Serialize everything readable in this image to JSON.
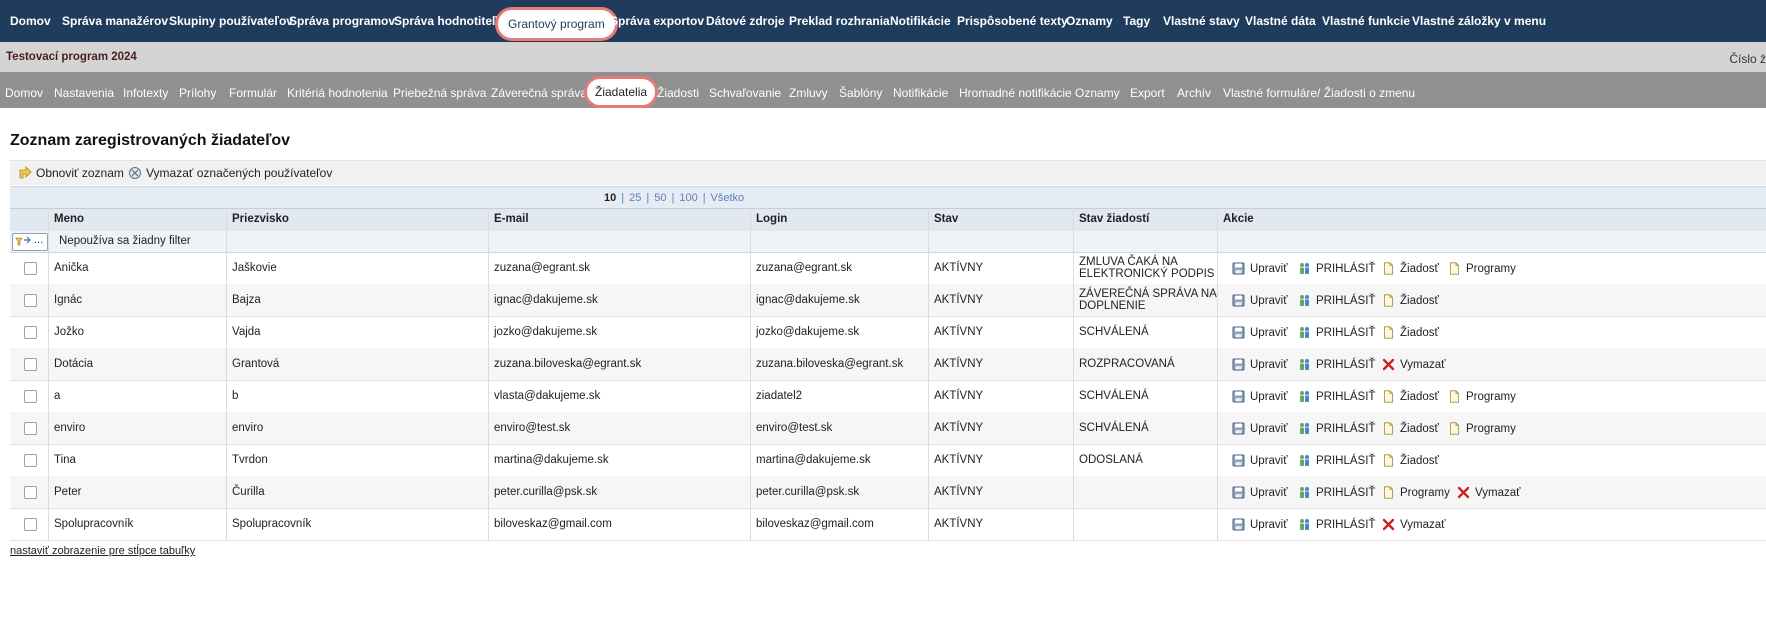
{
  "top_nav": [
    "Domov",
    "Správa manažérov",
    "Skupiny používateľov",
    "Správa programov",
    "Správa hodnotiteľov",
    "Grantový program",
    "Správa exportov",
    "Dátové zdroje",
    "Preklad rozhrania",
    "Notifikácie",
    "Prispôsobené texty",
    "Oznamy",
    "Tagy",
    "Vlastné stavy",
    "Vlastné dáta",
    "Vlastné funkcie",
    "Vlastné záložky v menu"
  ],
  "top_nav_active": "Grantový program",
  "program_title": "Testovací program 2024",
  "cislo_label": "Číslo ž",
  "sub_nav": [
    "Domov",
    "Nastavenia",
    "Infotexty",
    "Prílohy",
    "Formulár",
    "Kritériá hodnotenia",
    "Priebežná správa",
    "Záverečná správa",
    "Žiadatelia",
    "Žiadosti",
    "Schvaľovanie",
    "Zmluvy",
    "Šablóny",
    "Notifikácie",
    "Hromadné notifikácie",
    "Oznamy",
    "Export",
    "Archív",
    "Vlastné formuláre/ Žiadosti o zmenu"
  ],
  "sub_nav_active": "Žiadatelia",
  "page_title": "Zoznam zaregistrovaných žiadateľov",
  "toolbar": {
    "refresh": "Obnoviť zoznam",
    "delete_selected": "Vymazať označených používateľov"
  },
  "pager": {
    "current": "10",
    "options": [
      "25",
      "50",
      "100",
      "Všetko"
    ]
  },
  "columns": [
    "Meno",
    "Priezvisko",
    "E-mail",
    "Login",
    "Stav",
    "Stav žiadostí",
    "Akcie"
  ],
  "filter": {
    "button": "...",
    "text": "Nepoužíva sa žiadny filter"
  },
  "rows": [
    {
      "meno": "Anička",
      "priezvisko": "Jaškovie",
      "email": "zuzana@egrant.sk",
      "login": "zuzana@egrant.sk",
      "stav": "AKTÍVNY",
      "stav_ziadosti": [
        "ZMLUVA ČAKÁ NA",
        "ELEKTRONICKÝ PODPIS"
      ],
      "actions": [
        "Upraviť",
        "PRIHLÁSIŤ",
        "Žiadosť",
        "Programy"
      ]
    },
    {
      "meno": "Ignác",
      "priezvisko": "Bajza",
      "email": "ignac@dakujeme.sk",
      "login": "ignac@dakujeme.sk",
      "stav": "AKTÍVNY",
      "stav_ziadosti": [
        "ZÁVEREČNÁ SPRÁVA NA",
        "DOPLNENIE"
      ],
      "actions": [
        "Upraviť",
        "PRIHLÁSIŤ",
        "Žiadosť"
      ]
    },
    {
      "meno": "Jožko",
      "priezvisko": "Vajda",
      "email": "jozko@dakujeme.sk",
      "login": "jozko@dakujeme.sk",
      "stav": "AKTÍVNY",
      "stav_ziadosti": [
        "SCHVÁLENÁ"
      ],
      "actions": [
        "Upraviť",
        "PRIHLÁSIŤ",
        "Žiadosť"
      ]
    },
    {
      "meno": "Dotácia",
      "priezvisko": "Grantová",
      "email": "zuzana.biloveska@egrant.sk",
      "login": "zuzana.biloveska@egrant.sk",
      "stav": "AKTÍVNY",
      "stav_ziadosti": [
        "ROZPRACOVANÁ"
      ],
      "actions": [
        "Upraviť",
        "PRIHLÁSIŤ",
        "Vymazať"
      ]
    },
    {
      "meno": "a",
      "priezvisko": "b",
      "email": "vlasta@dakujeme.sk",
      "login": "ziadatel2",
      "stav": "AKTÍVNY",
      "stav_ziadosti": [
        "SCHVÁLENÁ"
      ],
      "actions": [
        "Upraviť",
        "PRIHLÁSIŤ",
        "Žiadosť",
        "Programy"
      ]
    },
    {
      "meno": "enviro",
      "priezvisko": "enviro",
      "email": "enviro@test.sk",
      "login": "enviro@test.sk",
      "stav": "AKTÍVNY",
      "stav_ziadosti": [
        "SCHVÁLENÁ"
      ],
      "actions": [
        "Upraviť",
        "PRIHLÁSIŤ",
        "Žiadosť",
        "Programy"
      ]
    },
    {
      "meno": "Tina",
      "priezvisko": "Tvrdon",
      "email": "martina@dakujeme.sk",
      "login": "martina@dakujeme.sk",
      "stav": "AKTÍVNY",
      "stav_ziadosti": [
        "ODOSLANÁ"
      ],
      "actions": [
        "Upraviť",
        "PRIHLÁSIŤ",
        "Žiadosť"
      ]
    },
    {
      "meno": "Peter",
      "priezvisko": "Čurilla",
      "email": "peter.curilla@psk.sk",
      "login": "peter.curilla@psk.sk",
      "stav": "AKTÍVNY",
      "stav_ziadosti": [],
      "actions": [
        "Upraviť",
        "PRIHLÁSIŤ",
        "Programy",
        "Vymazať"
      ]
    },
    {
      "meno": "Spolupracovník",
      "priezvisko": "Spolupracovník",
      "email": "biloveskaz@gmail.com",
      "login": "biloveskaz@gmail.com",
      "stav": "AKTÍVNY",
      "stav_ziadosti": [],
      "actions": [
        "Upraviť",
        "PRIHLÁSIŤ",
        "Vymazať"
      ]
    }
  ],
  "footer_link": "nastaviť zobrazenie pre stĺpce tabuľky",
  "colors": {
    "top_nav_bg": "#1f3c5d",
    "sub_nav_bg": "#909090",
    "highlight": "#e87979",
    "link": "#5b82b8",
    "delete_red": "#cc2222"
  }
}
